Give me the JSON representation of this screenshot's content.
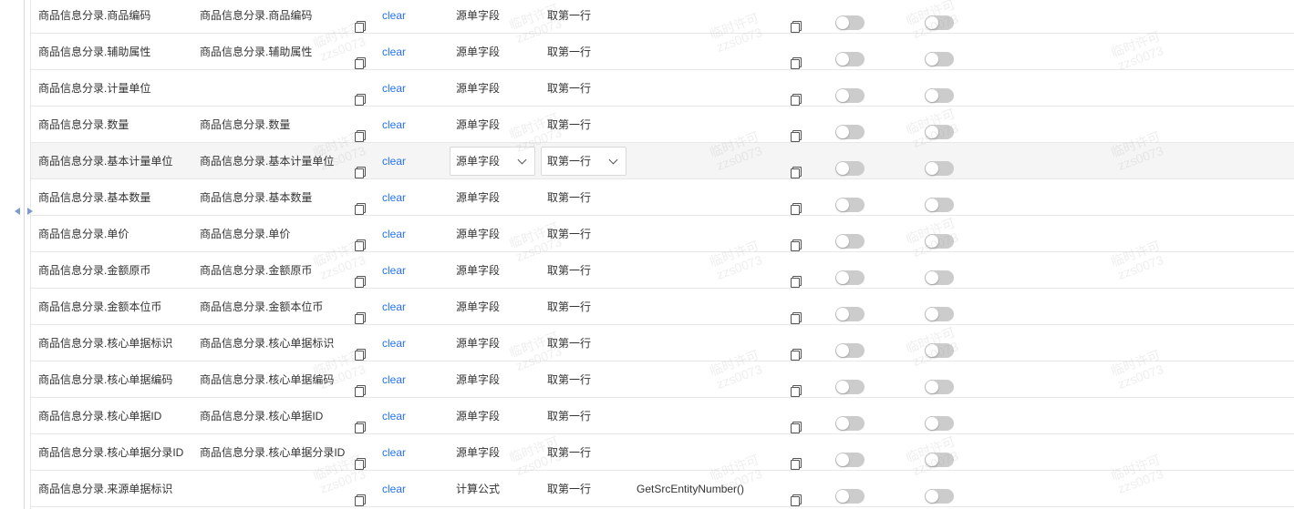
{
  "watermark": {
    "line1": "临时许可",
    "line2": "zzs0073"
  },
  "clear_label": "clear",
  "rows": [
    {
      "source": "商品信息分录.商品编码",
      "target": "商品信息分录.商品编码",
      "type": "源单字段",
      "take": "取第一行",
      "formula": ""
    },
    {
      "source": "商品信息分录.辅助属性",
      "target": "商品信息分录.辅助属性",
      "type": "源单字段",
      "take": "取第一行",
      "formula": ""
    },
    {
      "source": "商品信息分录.计量单位",
      "target": "",
      "type": "源单字段",
      "take": "取第一行",
      "formula": ""
    },
    {
      "source": "商品信息分录.数量",
      "target": "商品信息分录.数量",
      "type": "源单字段",
      "take": "取第一行",
      "formula": ""
    },
    {
      "source": "商品信息分录.基本计量单位",
      "target": "商品信息分录.基本计量单位",
      "type": "源单字段",
      "take": "取第一行",
      "formula": ""
    },
    {
      "source": "商品信息分录.基本数量",
      "target": "商品信息分录.基本数量",
      "type": "源单字段",
      "take": "取第一行",
      "formula": ""
    },
    {
      "source": "商品信息分录.单价",
      "target": "商品信息分录.单价",
      "type": "源单字段",
      "take": "取第一行",
      "formula": ""
    },
    {
      "source": "商品信息分录.金额原币",
      "target": "商品信息分录.金额原币",
      "type": "源单字段",
      "take": "取第一行",
      "formula": ""
    },
    {
      "source": "商品信息分录.金额本位币",
      "target": "商品信息分录.金额本位币",
      "type": "源单字段",
      "take": "取第一行",
      "formula": ""
    },
    {
      "source": "商品信息分录.核心单据标识",
      "target": "商品信息分录.核心单据标识",
      "type": "源单字段",
      "take": "取第一行",
      "formula": ""
    },
    {
      "source": "商品信息分录.核心单据编码",
      "target": "商品信息分录.核心单据编码",
      "type": "源单字段",
      "take": "取第一行",
      "formula": ""
    },
    {
      "source": "商品信息分录.核心单据ID",
      "target": "商品信息分录.核心单据ID",
      "type": "源单字段",
      "take": "取第一行",
      "formula": ""
    },
    {
      "source": "商品信息分录.核心单据分录ID",
      "target": "商品信息分录.核心单据分录ID",
      "type": "源单字段",
      "take": "取第一行",
      "formula": ""
    },
    {
      "source": "商品信息分录.来源单据标识",
      "target": "",
      "type": "计算公式",
      "take": "取第一行",
      "formula": "GetSrcEntityNumber()"
    }
  ],
  "switch_states": {
    "enabled": "off",
    "required": "off"
  },
  "colors": {
    "link": "#276ff5",
    "switch_off": "#cccccc",
    "row_active_bg": "#f5f5f5"
  }
}
